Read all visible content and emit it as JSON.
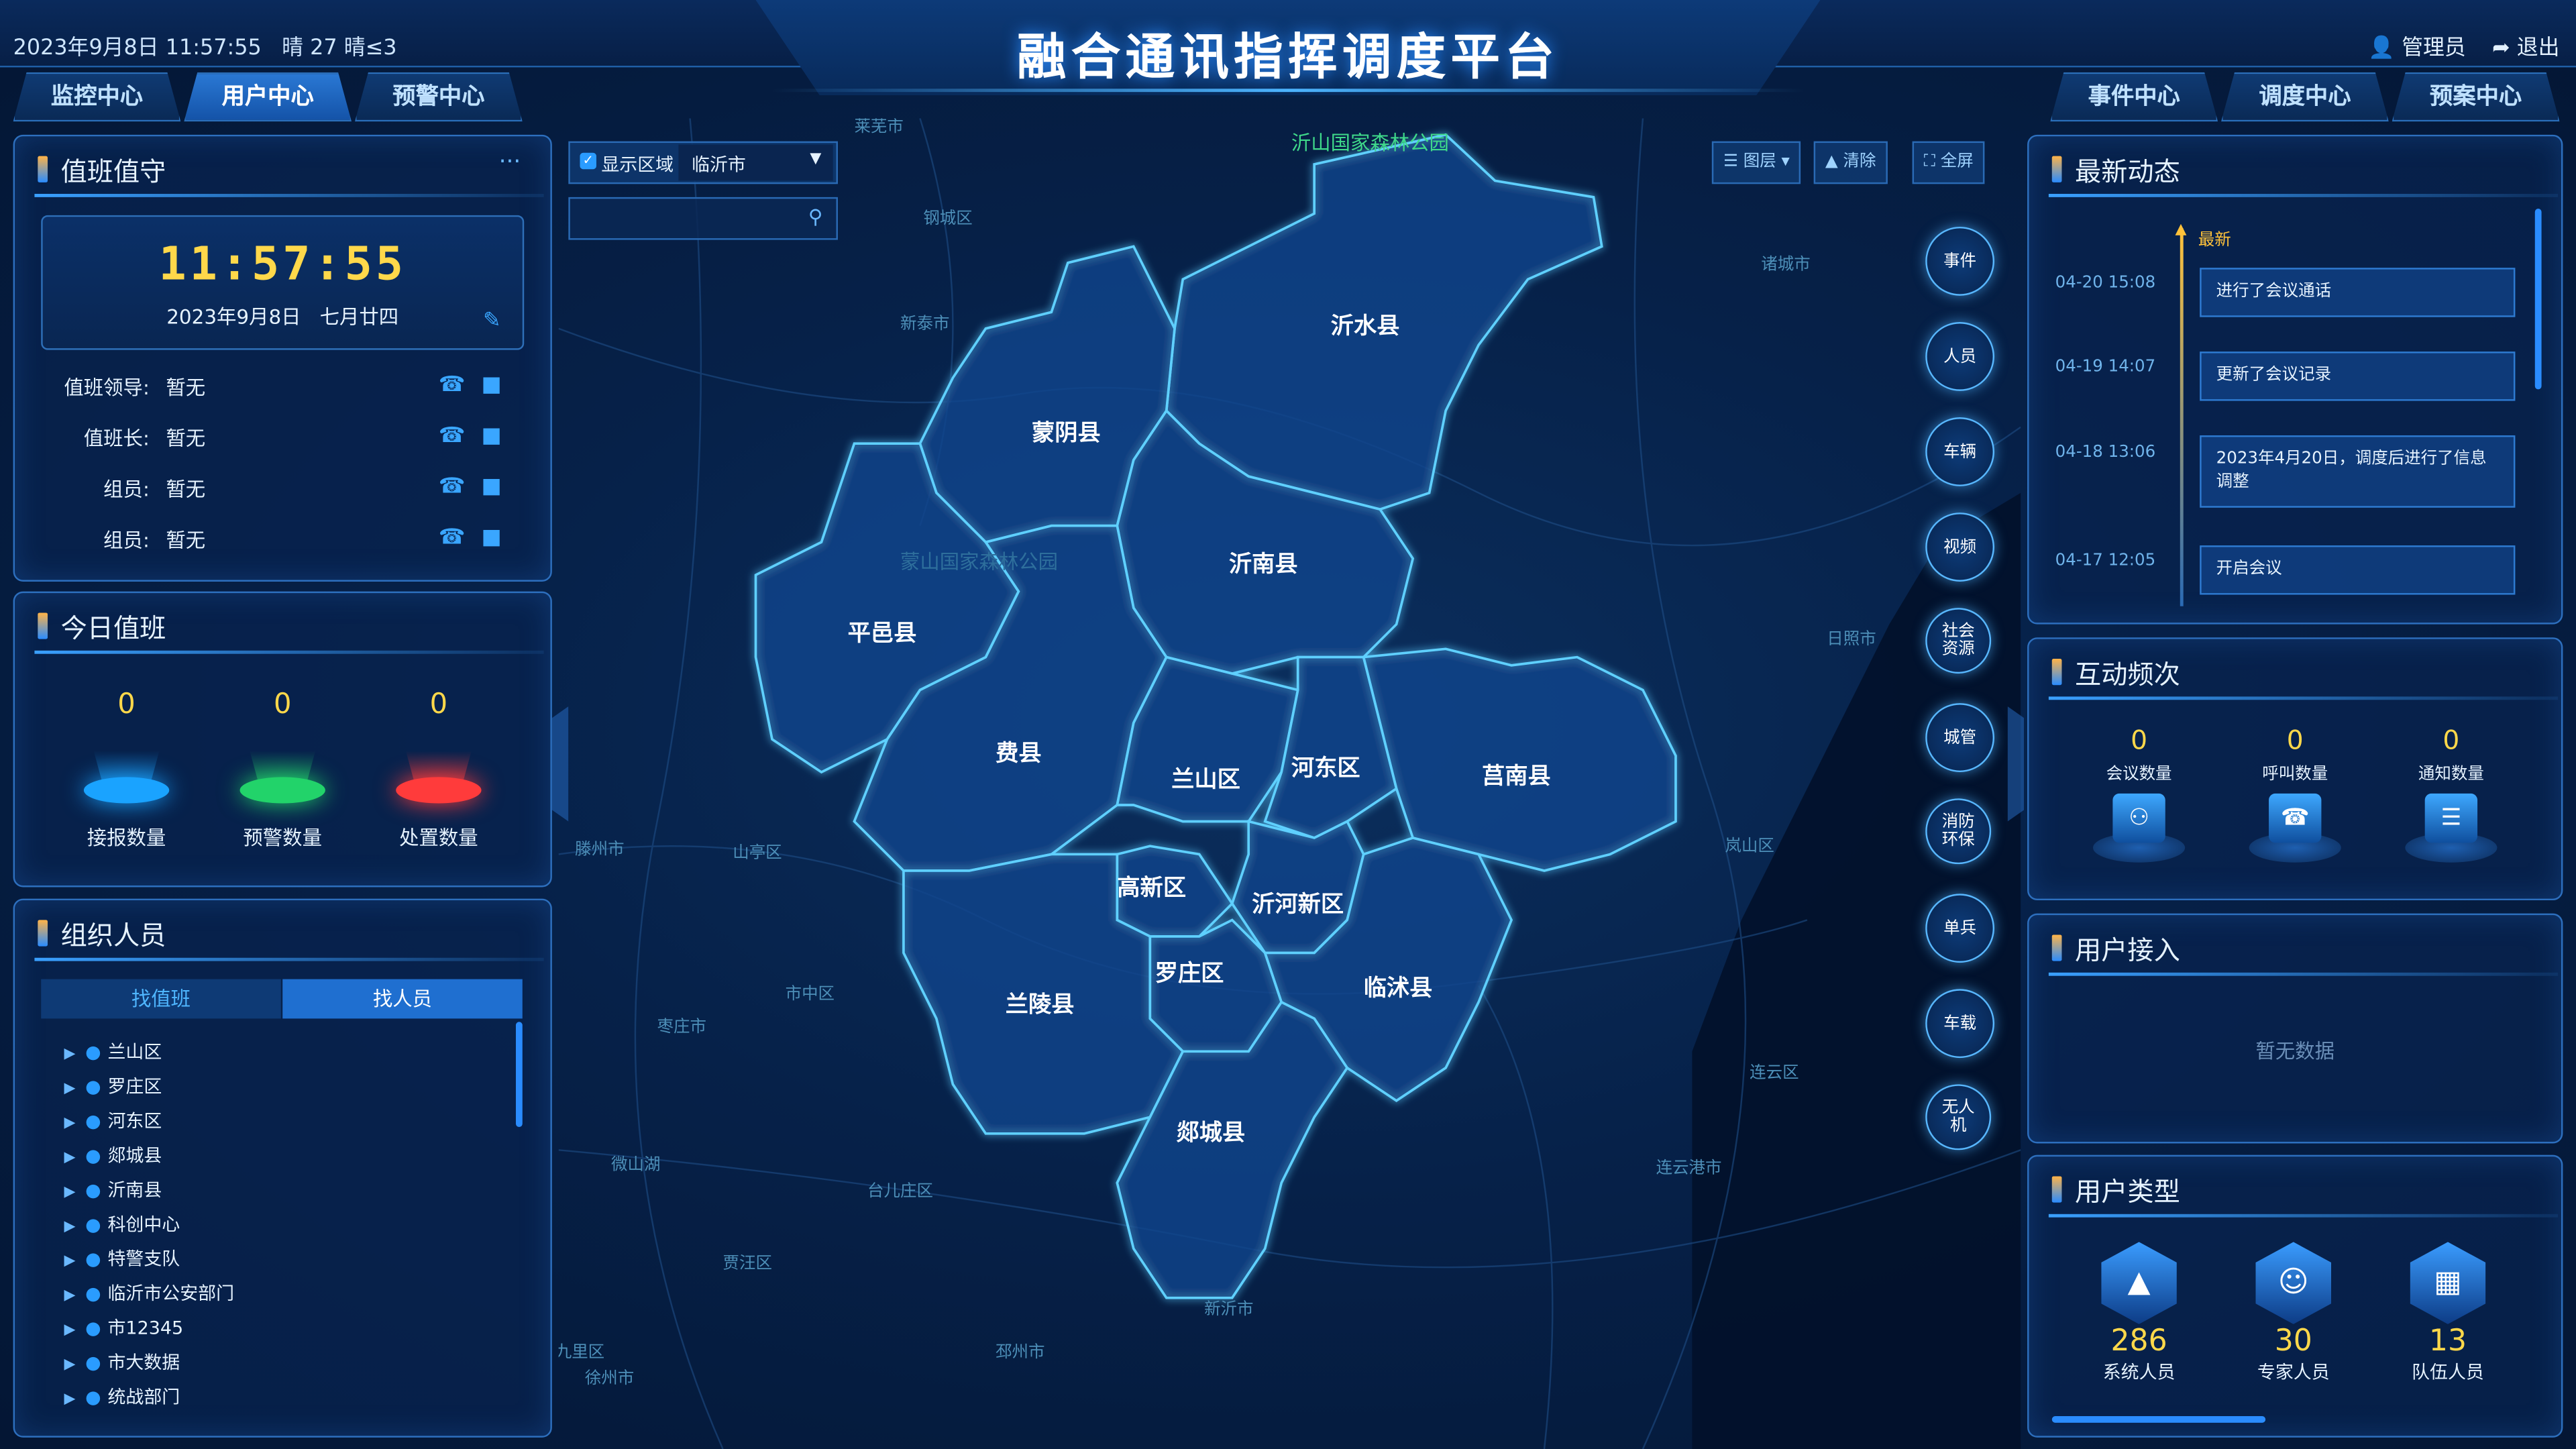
{
  "header": {
    "title": "融合通讯指挥调度平台",
    "datetime": "2023年9月8日 11:57:55",
    "weather": "晴 27 晴≤3",
    "user": "管理员",
    "logout": "退出",
    "tabs_left": [
      "监控中心",
      "用户中心",
      "预警中心"
    ],
    "tabs_right": [
      "事件中心",
      "调度中心",
      "预案中心"
    ],
    "active_tab": "用户中心"
  },
  "duty": {
    "title": "值班值守",
    "more": "···",
    "clock": "11:57:55",
    "date": "2023年9月8日",
    "lunar": "七月廿四",
    "rows": [
      {
        "label": "值班领导:",
        "value": "暂无"
      },
      {
        "label": "值班长:",
        "value": "暂无"
      },
      {
        "label": "组员:",
        "value": "暂无"
      },
      {
        "label": "组员:",
        "value": "暂无"
      }
    ]
  },
  "today": {
    "title": "今日值班",
    "stats": [
      {
        "value": "0",
        "label": "接报数量",
        "color": "#1aa3ff"
      },
      {
        "value": "0",
        "label": "预警数量",
        "color": "#22d36a"
      },
      {
        "value": "0",
        "label": "处置数量",
        "color": "#ff3b3b"
      }
    ]
  },
  "org": {
    "title": "组织人员",
    "tabs": [
      "找值班",
      "找人员"
    ],
    "items": [
      "兰山区",
      "罗庄区",
      "河东区",
      "郯城县",
      "沂南县",
      "科创中心",
      "特警支队",
      "临沂市公安部门",
      "市12345",
      "市大数据",
      "统战部门"
    ]
  },
  "map": {
    "show_area_label": "显示区域",
    "area_select": "临沂市",
    "search_placeholder": "",
    "tools": [
      "图层",
      "清除",
      "全屏"
    ],
    "counties": [
      "沂水县",
      "蒙阴县",
      "沂南县",
      "平邑县",
      "费县",
      "兰山区",
      "河东区",
      "莒南县",
      "高新区",
      "沂河新区",
      "罗庄区",
      "兰陵县",
      "临沭县",
      "郯城县"
    ],
    "bg_places": [
      "莱芜市",
      "钢城区",
      "新泰市",
      "沂山国家森林公园",
      "诸城市",
      "蒙山国家森林公园",
      "日照市",
      "滕州市",
      "山亭区",
      "岚山区",
      "市中区",
      "枣庄市",
      "连云区",
      "微山湖",
      "台儿庄区",
      "连云港市",
      "贾汪区",
      "新沂市",
      "九里区",
      "邳州市",
      "徐州市"
    ],
    "side_buttons": [
      "事件",
      "人员",
      "车辆",
      "视频",
      "社会资源",
      "城管",
      "消防环保",
      "单兵",
      "车载",
      "无人机"
    ]
  },
  "news": {
    "title": "最新动态",
    "latest": "最新",
    "items": [
      {
        "time": "04-20 15:08",
        "text": "进行了会议通话"
      },
      {
        "time": "04-19 14:07",
        "text": "更新了会议记录"
      },
      {
        "time": "04-18 13:06",
        "text": "2023年4月20日，调度后进行了信息调整"
      },
      {
        "time": "04-17 12:05",
        "text": "开启会议"
      }
    ]
  },
  "interaction": {
    "title": "互动频次",
    "items": [
      {
        "value": "0",
        "label": "会议数量",
        "icon": "meeting-icon"
      },
      {
        "value": "0",
        "label": "呼叫数量",
        "icon": "call-icon"
      },
      {
        "value": "0",
        "label": "通知数量",
        "icon": "notice-icon"
      }
    ]
  },
  "access": {
    "title": "用户接入",
    "empty": "暂无数据"
  },
  "user_type": {
    "title": "用户类型",
    "items": [
      {
        "value": "286",
        "label": "系统人员",
        "icon": "graduation-cap-icon"
      },
      {
        "value": "30",
        "label": "专家人员",
        "icon": "people-icon"
      },
      {
        "value": "13",
        "label": "队伍人员",
        "icon": "building-icon"
      }
    ]
  }
}
